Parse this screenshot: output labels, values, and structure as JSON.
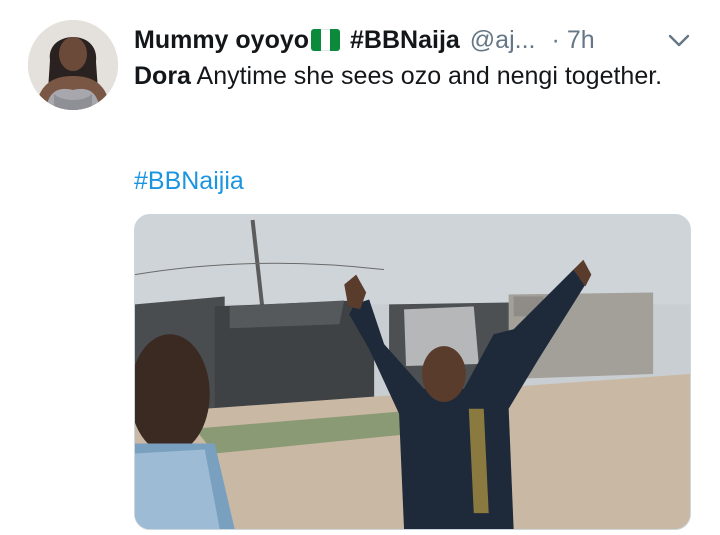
{
  "tweet": {
    "display_name": "Mummy oyoyo",
    "name_hashtag": "#BBNaija",
    "handle": "@aj...",
    "separator": "·",
    "time": "7h",
    "text_mention": "Dora",
    "text_body": " Anytime she sees ozo and nengi together.",
    "hashtag": "#BBNaijia"
  },
  "icons": {
    "flag": "nigeria-flag-icon",
    "menu": "chevron-down-icon"
  },
  "colors": {
    "link": "#1b95e0",
    "secondary_text": "#657786",
    "primary_text": "#14171a",
    "flag_green": "#0a8a3a"
  }
}
